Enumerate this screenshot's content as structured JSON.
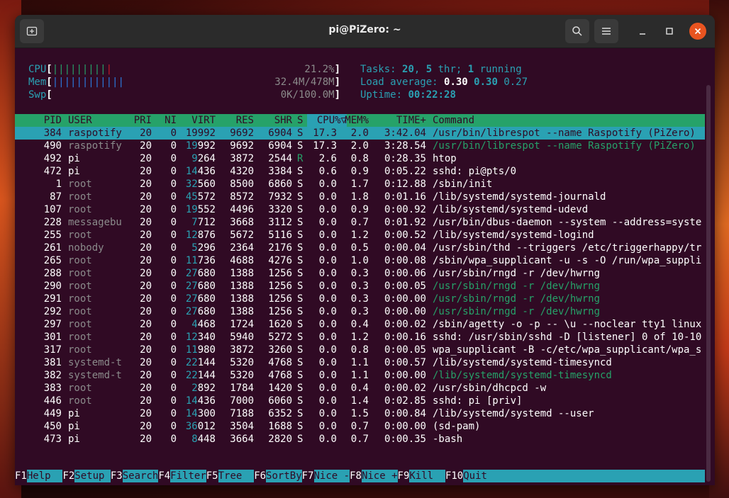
{
  "window": {
    "title": "pi@PiZero: ~"
  },
  "meters": {
    "cpu": {
      "label": "CPU",
      "bars": "|||||||||",
      "last_bar": "|",
      "value": "21.2%"
    },
    "mem": {
      "label": "Mem",
      "bars": "||||||||||||",
      "value": "32.4M/478M"
    },
    "swp": {
      "label": "Swp",
      "value": "0K/100.0M"
    },
    "tasks": {
      "label": "Tasks: ",
      "count": "20",
      "sep": ", ",
      "thr": "5",
      "thr_label": " thr; ",
      "running": "1",
      "running_label": " running"
    },
    "load": {
      "label": "Load average: ",
      "v1": "0.30",
      "v2": "0.30",
      "v3": "0.27"
    },
    "uptime": {
      "label": "Uptime: ",
      "value": "00:22:28"
    }
  },
  "columns": {
    "pid": "PID",
    "user": "USER",
    "pri": "PRI",
    "ni": "NI",
    "virt": "VIRT",
    "res": "RES",
    "shr": "SHR",
    "s": "S",
    "cpu": "CPU%",
    "sort_mark": "▽",
    "mem": "MEM%",
    "time": "TIME+",
    "command": "Command"
  },
  "processes": [
    {
      "pid": "384",
      "user": "raspotify",
      "pri": "20",
      "ni": "0",
      "virt": "19992",
      "res": "9692",
      "shr": "6904",
      "s": "S",
      "cpu": "17.3",
      "mem": "2.0",
      "time": "3:42.04",
      "cmd": "/usr/bin/librespot --name Raspotify (PiZero)",
      "selected": true
    },
    {
      "pid": "490",
      "user": "raspotify",
      "pri": "20",
      "ni": "0",
      "virt": "19992",
      "res": "9692",
      "shr": "6904",
      "s": "S",
      "cpu": "17.3",
      "mem": "2.0",
      "time": "3:28.54",
      "cmd": "/usr/bin/librespot --name Raspotify (PiZero)",
      "thread": true
    },
    {
      "pid": "492",
      "user": "pi",
      "pri": "20",
      "ni": "0",
      "virt": "9264",
      "res": "3872",
      "shr": "2544",
      "s": "R",
      "cpu": "2.6",
      "mem": "0.8",
      "time": "0:28.35",
      "cmd": "htop"
    },
    {
      "pid": "472",
      "user": "pi",
      "pri": "20",
      "ni": "0",
      "virt": "14436",
      "res": "4320",
      "shr": "3384",
      "s": "S",
      "cpu": "0.6",
      "mem": "0.9",
      "time": "0:05.22",
      "cmd": "sshd: pi@pts/0"
    },
    {
      "pid": "1",
      "user": "root",
      "pri": "20",
      "ni": "0",
      "virt": "32560",
      "res": "8500",
      "shr": "6860",
      "s": "S",
      "cpu": "0.0",
      "mem": "1.7",
      "time": "0:12.88",
      "cmd": "/sbin/init"
    },
    {
      "pid": "87",
      "user": "root",
      "pri": "20",
      "ni": "0",
      "virt": "45572",
      "res": "8572",
      "shr": "7932",
      "s": "S",
      "cpu": "0.0",
      "mem": "1.8",
      "time": "0:01.16",
      "cmd": "/lib/systemd/systemd-journald"
    },
    {
      "pid": "107",
      "user": "root",
      "pri": "20",
      "ni": "0",
      "virt": "19552",
      "res": "4496",
      "shr": "3320",
      "s": "S",
      "cpu": "0.0",
      "mem": "0.9",
      "time": "0:00.92",
      "cmd": "/lib/systemd/systemd-udevd"
    },
    {
      "pid": "228",
      "user": "messagebu",
      "pri": "20",
      "ni": "0",
      "virt": "7712",
      "res": "3668",
      "shr": "3112",
      "s": "S",
      "cpu": "0.0",
      "mem": "0.7",
      "time": "0:01.92",
      "cmd": "/usr/bin/dbus-daemon --system --address=syste"
    },
    {
      "pid": "255",
      "user": "root",
      "pri": "20",
      "ni": "0",
      "virt": "12876",
      "res": "5672",
      "shr": "5116",
      "s": "S",
      "cpu": "0.0",
      "mem": "1.2",
      "time": "0:00.52",
      "cmd": "/lib/systemd/systemd-logind"
    },
    {
      "pid": "261",
      "user": "nobody",
      "pri": "20",
      "ni": "0",
      "virt": "5296",
      "res": "2364",
      "shr": "2176",
      "s": "S",
      "cpu": "0.0",
      "mem": "0.5",
      "time": "0:00.04",
      "cmd": "/usr/sbin/thd --triggers /etc/triggerhappy/tr"
    },
    {
      "pid": "265",
      "user": "root",
      "pri": "20",
      "ni": "0",
      "virt": "11736",
      "res": "4688",
      "shr": "4276",
      "s": "S",
      "cpu": "0.0",
      "mem": "1.0",
      "time": "0:00.08",
      "cmd": "/sbin/wpa_supplicant -u -s -O /run/wpa_suppli"
    },
    {
      "pid": "288",
      "user": "root",
      "pri": "20",
      "ni": "0",
      "virt": "27680",
      "res": "1388",
      "shr": "1256",
      "s": "S",
      "cpu": "0.0",
      "mem": "0.3",
      "time": "0:00.06",
      "cmd": "/usr/sbin/rngd -r /dev/hwrng"
    },
    {
      "pid": "290",
      "user": "root",
      "pri": "20",
      "ni": "0",
      "virt": "27680",
      "res": "1388",
      "shr": "1256",
      "s": "S",
      "cpu": "0.0",
      "mem": "0.3",
      "time": "0:00.05",
      "cmd": "/usr/sbin/rngd -r /dev/hwrng",
      "thread": true
    },
    {
      "pid": "291",
      "user": "root",
      "pri": "20",
      "ni": "0",
      "virt": "27680",
      "res": "1388",
      "shr": "1256",
      "s": "S",
      "cpu": "0.0",
      "mem": "0.3",
      "time": "0:00.00",
      "cmd": "/usr/sbin/rngd -r /dev/hwrng",
      "thread": true
    },
    {
      "pid": "292",
      "user": "root",
      "pri": "20",
      "ni": "0",
      "virt": "27680",
      "res": "1388",
      "shr": "1256",
      "s": "S",
      "cpu": "0.0",
      "mem": "0.3",
      "time": "0:00.00",
      "cmd": "/usr/sbin/rngd -r /dev/hwrng",
      "thread": true
    },
    {
      "pid": "297",
      "user": "root",
      "pri": "20",
      "ni": "0",
      "virt": "4468",
      "res": "1724",
      "shr": "1620",
      "s": "S",
      "cpu": "0.0",
      "mem": "0.4",
      "time": "0:00.02",
      "cmd": "/sbin/agetty -o -p -- \\u --noclear tty1 linux"
    },
    {
      "pid": "301",
      "user": "root",
      "pri": "20",
      "ni": "0",
      "virt": "12340",
      "res": "5940",
      "shr": "5272",
      "s": "S",
      "cpu": "0.0",
      "mem": "1.2",
      "time": "0:00.16",
      "cmd": "sshd: /usr/sbin/sshd -D [listener] 0 of 10-10"
    },
    {
      "pid": "317",
      "user": "root",
      "pri": "20",
      "ni": "0",
      "virt": "11980",
      "res": "3872",
      "shr": "3260",
      "s": "S",
      "cpu": "0.0",
      "mem": "0.8",
      "time": "0:00.05",
      "cmd": "wpa_supplicant -B -c/etc/wpa_supplicant/wpa_s"
    },
    {
      "pid": "381",
      "user": "systemd-t",
      "pri": "20",
      "ni": "0",
      "virt": "22144",
      "res": "5320",
      "shr": "4768",
      "s": "S",
      "cpu": "0.0",
      "mem": "1.1",
      "time": "0:00.57",
      "cmd": "/lib/systemd/systemd-timesyncd"
    },
    {
      "pid": "382",
      "user": "systemd-t",
      "pri": "20",
      "ni": "0",
      "virt": "22144",
      "res": "5320",
      "shr": "4768",
      "s": "S",
      "cpu": "0.0",
      "mem": "1.1",
      "time": "0:00.00",
      "cmd": "/lib/systemd/systemd-timesyncd",
      "thread": true
    },
    {
      "pid": "383",
      "user": "root",
      "pri": "20",
      "ni": "0",
      "virt": "2892",
      "res": "1784",
      "shr": "1420",
      "s": "S",
      "cpu": "0.0",
      "mem": "0.4",
      "time": "0:00.02",
      "cmd": "/usr/sbin/dhcpcd -w"
    },
    {
      "pid": "446",
      "user": "root",
      "pri": "20",
      "ni": "0",
      "virt": "14436",
      "res": "7000",
      "shr": "6060",
      "s": "S",
      "cpu": "0.0",
      "mem": "1.4",
      "time": "0:02.85",
      "cmd": "sshd: pi [priv]"
    },
    {
      "pid": "449",
      "user": "pi",
      "pri": "20",
      "ni": "0",
      "virt": "14300",
      "res": "7188",
      "shr": "6352",
      "s": "S",
      "cpu": "0.0",
      "mem": "1.5",
      "time": "0:00.84",
      "cmd": "/lib/systemd/systemd --user"
    },
    {
      "pid": "450",
      "user": "pi",
      "pri": "20",
      "ni": "0",
      "virt": "36012",
      "res": "3504",
      "shr": "1688",
      "s": "S",
      "cpu": "0.0",
      "mem": "0.7",
      "time": "0:00.00",
      "cmd": "(sd-pam)"
    },
    {
      "pid": "473",
      "user": "pi",
      "pri": "20",
      "ni": "0",
      "virt": "8448",
      "res": "3664",
      "shr": "2820",
      "s": "S",
      "cpu": "0.0",
      "mem": "0.7",
      "time": "0:00.35",
      "cmd": "-bash"
    }
  ],
  "fkeys": [
    {
      "key": "F1",
      "label": "Help  "
    },
    {
      "key": "F2",
      "label": "Setup "
    },
    {
      "key": "F3",
      "label": "Search"
    },
    {
      "key": "F4",
      "label": "Filter"
    },
    {
      "key": "F5",
      "label": "Tree  "
    },
    {
      "key": "F6",
      "label": "SortBy"
    },
    {
      "key": "F7",
      "label": "Nice -"
    },
    {
      "key": "F8",
      "label": "Nice +"
    },
    {
      "key": "F9",
      "label": "Kill  "
    },
    {
      "key": "F10",
      "label": "Quit"
    }
  ],
  "icons": {
    "new_tab": "new-tab-icon",
    "search": "search-icon",
    "menu": "hamburger-menu-icon",
    "minimize": "minimize-icon",
    "maximize": "maximize-icon",
    "close": "close-icon"
  },
  "colors": {
    "terminal_bg": "#300a24",
    "cyan": "#2aa1b3",
    "green": "#26a269",
    "accent": "#e95420"
  }
}
